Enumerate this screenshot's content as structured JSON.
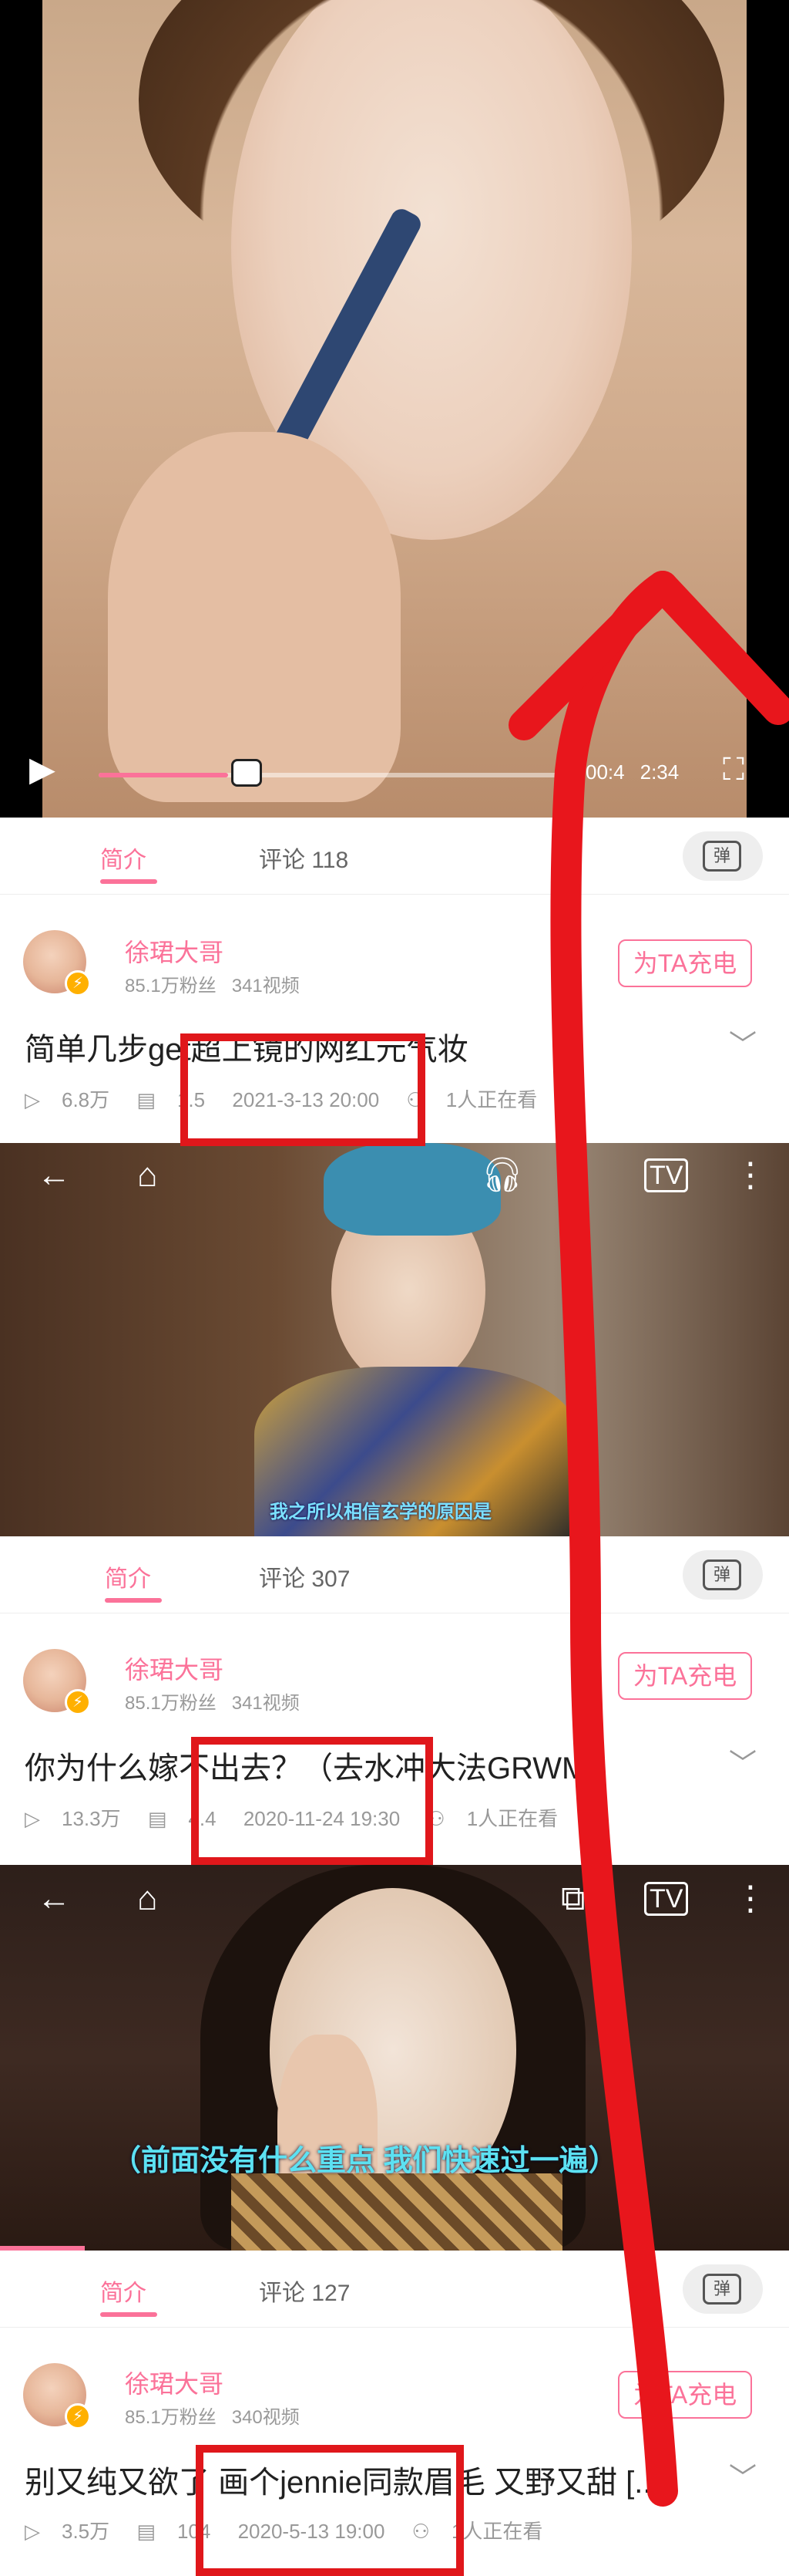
{
  "player": {
    "time_text": "00:4",
    "time_text_end": "2:34"
  },
  "tabs_label_intro": "简介",
  "entries": [
    {
      "comment_label": "评论 118",
      "uploader": "徐珺大哥",
      "followers": "85.1万粉丝",
      "videos": "341视频",
      "charge_label": "为TA充电",
      "title": "简单几步get超上镜的网红元气妆",
      "views": "6.8万",
      "danmaku": "1.5",
      "date": "2021-3-13 20:00",
      "watching": "1人正在看"
    },
    {
      "comment_label": "评论 307",
      "uploader": "徐珺大哥",
      "followers": "85.1万粉丝",
      "videos": "341视频",
      "charge_label": "为TA充电",
      "title": "你为什么嫁不出去？（去水冲大法GRWM",
      "views": "13.3万",
      "danmaku": "4.4",
      "date": "2020-11-24 19:30",
      "watching": "1人正在看",
      "subtitle": "我之所以相信玄学的原因是"
    },
    {
      "comment_label": "评论 127",
      "uploader": "徐珺大哥",
      "followers": "85.1万粉丝",
      "videos": "340视频",
      "charge_label": "为TA充电",
      "title": "别又纯又欲了 画个jennie同款眉毛 又野又甜 [...",
      "views": "3.5万",
      "danmaku": "104",
      "date": "2020-5-13 19:00",
      "watching": "1人正在看",
      "subtitle": "（前面没有什么重点 我们快速过一遍）"
    }
  ],
  "icons": {
    "play": "play-icon",
    "fullscreen": "fullscreen-icon",
    "back": "back-arrow-icon",
    "home": "home-icon",
    "headphones": "headphones-icon",
    "pip": "picture-in-picture-icon",
    "tv": "tv-cast-icon",
    "more": "more-vertical-icon",
    "danmu": "danmaku-toggle-icon"
  },
  "colors": {
    "accent": "#fb7299",
    "annotation": "#e0171b"
  }
}
